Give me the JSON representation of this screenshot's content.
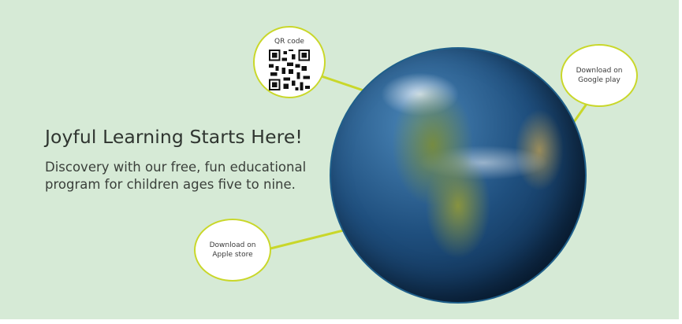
{
  "banner": {
    "headline": "Joyful Learning Starts Here!",
    "subtext": "Discovery with our free, fun educational program for children ages five to nine."
  },
  "bubbles": {
    "qr": {
      "label": "QR code",
      "icon": "qr-code-icon"
    },
    "google": {
      "line1": "Download on",
      "line2": "Google play"
    },
    "apple": {
      "line1": "Download on",
      "line2": "Apple store"
    }
  },
  "colors": {
    "background": "#d6ead6",
    "accent": "#c9d72a",
    "text": "#2f3530",
    "globe_ocean": "#1f4f7e"
  }
}
